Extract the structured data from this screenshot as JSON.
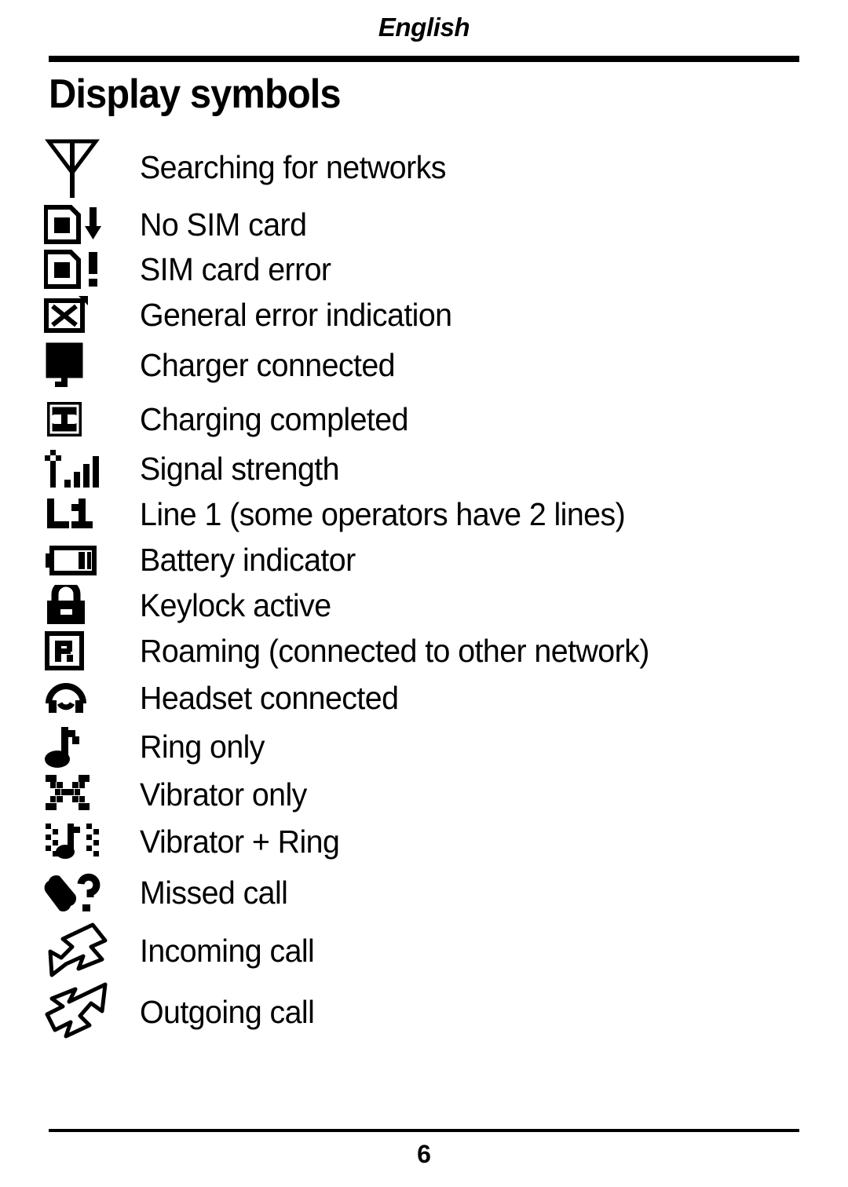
{
  "header": {
    "language": "English",
    "title": "Display symbols"
  },
  "symbols": [
    {
      "icon": "antenna-searching-icon",
      "label": "Searching for networks"
    },
    {
      "icon": "sim-card-missing-icon",
      "label": "No SIM card"
    },
    {
      "icon": "sim-card-error-icon",
      "label": "SIM card error"
    },
    {
      "icon": "general-error-icon",
      "label": "General error indication"
    },
    {
      "icon": "charger-connected-icon",
      "label": "Charger connected"
    },
    {
      "icon": "charging-completed-icon",
      "label": "Charging completed"
    },
    {
      "icon": "signal-strength-icon",
      "label": "Signal strength"
    },
    {
      "icon": "line-one-icon",
      "label": "Line 1 (some operators have 2 lines)"
    },
    {
      "icon": "battery-indicator-icon",
      "label": "Battery indicator"
    },
    {
      "icon": "keylock-padlock-icon",
      "label": "Keylock active"
    },
    {
      "icon": "roaming-icon",
      "label": "Roaming (connected to other network)"
    },
    {
      "icon": "headset-icon",
      "label": "Headset connected"
    },
    {
      "icon": "ring-note-icon",
      "label": "Ring only"
    },
    {
      "icon": "vibrator-icon",
      "label": "Vibrator only"
    },
    {
      "icon": "vibrator-ring-icon",
      "label": "Vibrator + Ring"
    },
    {
      "icon": "missed-call-icon",
      "label": "Missed call"
    },
    {
      "icon": "incoming-call-arrow-icon",
      "label": "Incoming call"
    },
    {
      "icon": "outgoing-call-arrow-icon",
      "label": "Outgoing call"
    }
  ],
  "footer": {
    "page_number": "6"
  },
  "colors": {
    "ink": "#000000",
    "paper": "#ffffff"
  }
}
